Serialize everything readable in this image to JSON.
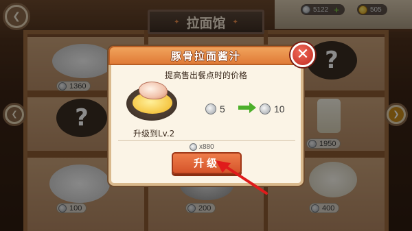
{
  "currencies": {
    "silver": "5122",
    "gold": "505"
  },
  "sign": {
    "title": "拉面馆"
  },
  "shelf": {
    "prices": [
      "1360",
      "1950",
      "100",
      "200",
      "400"
    ]
  },
  "dialog": {
    "title": "豚骨拉面酱汁",
    "subtitle": "提高售出餐点时的价格",
    "current_value": "5",
    "next_value": "10",
    "level_text": "升级到Lv.2",
    "cost": "x880",
    "upgrade_label": "升级",
    "close_glyph": "✕"
  },
  "colors": {
    "header_orange": "#e07b37",
    "button_orange": "#d5542a",
    "close_red": "#c0281e",
    "arrow_green": "#4caf2a",
    "hint_red": "#e01b1b"
  },
  "icons": [
    "back-arrow-icon",
    "silver-coin-icon",
    "gold-coin-icon",
    "plus-icon",
    "close-icon",
    "right-arrow-icon",
    "left-arrow-icon",
    "question-mark-icon"
  ]
}
